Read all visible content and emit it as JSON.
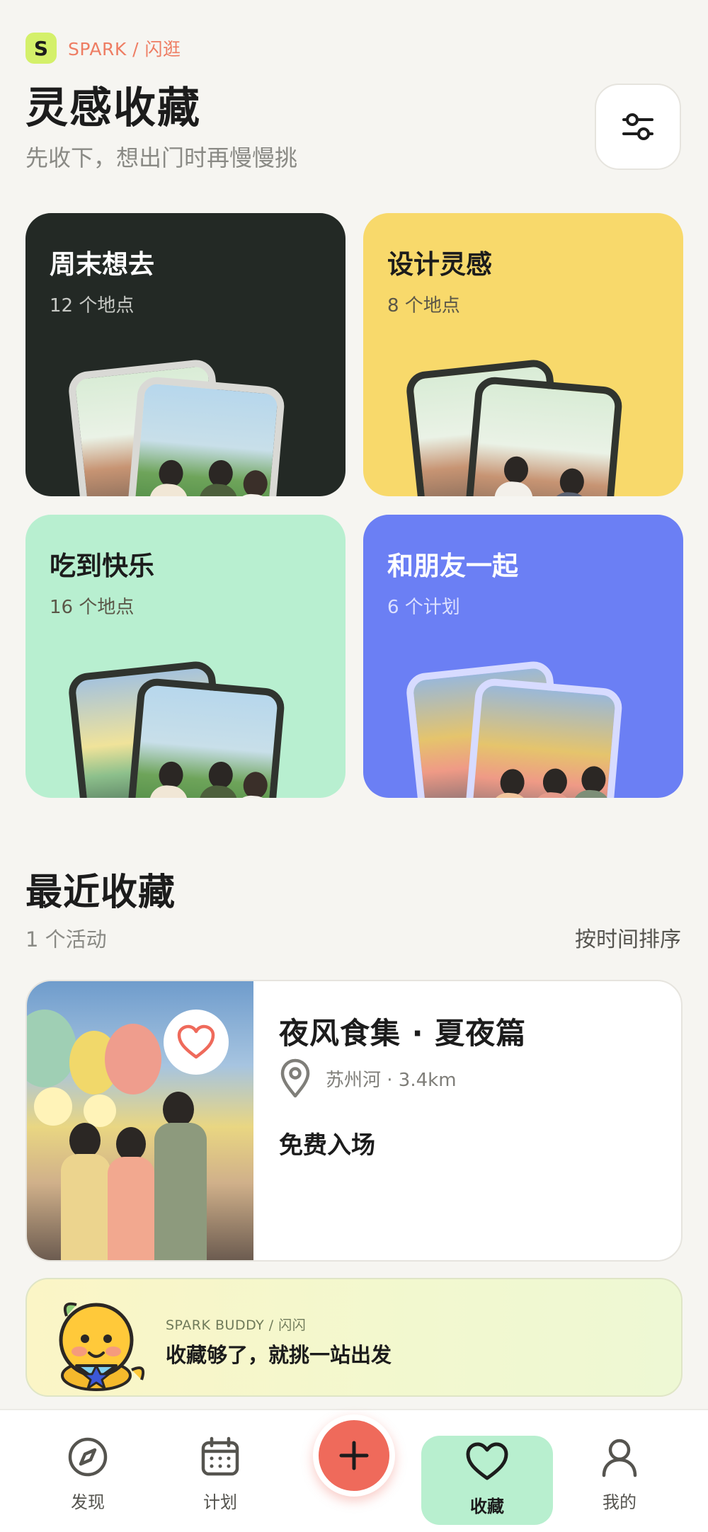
{
  "brand": {
    "logo_letter": "S",
    "name": "SPARK / 闪逛"
  },
  "header": {
    "title": "灵感收藏",
    "subtitle": "先收下，想出门时再慢慢挑",
    "filter_icon": "sliders-icon"
  },
  "collections": [
    {
      "title": "周末想去",
      "count": "12 个地点",
      "color": "#232925"
    },
    {
      "title": "设计灵感",
      "count": "8 个地点",
      "color": "#f8d96b"
    },
    {
      "title": "吃到快乐",
      "count": "16 个地点",
      "color": "#b8efd0"
    },
    {
      "title": "和朋友一起",
      "count": "6 个计划",
      "color": "#6b7ff4"
    }
  ],
  "recent": {
    "title": "最近收藏",
    "count": "1 个活动",
    "sort_label": "按时间排序",
    "items": [
      {
        "title": "夜风食集 · 夏夜篇",
        "location": "苏州河 · 3.4km",
        "price": "免费入场",
        "favorite_icon": "heart-icon"
      }
    ]
  },
  "buddy": {
    "label": "SPARK BUDDY / 闪闪",
    "message": "收藏够了，就挑一站出发"
  },
  "tabs": [
    {
      "label": "发现",
      "icon": "compass-icon"
    },
    {
      "label": "计划",
      "icon": "calendar-icon"
    },
    {
      "label": "收藏",
      "icon": "heart-icon",
      "active": true
    },
    {
      "label": "我的",
      "icon": "user-icon"
    }
  ],
  "fab_icon": "plus-icon",
  "colors": {
    "accent": "#ef6a5b",
    "brand": "#ee7d63",
    "active_tab": "#b8efcf"
  }
}
